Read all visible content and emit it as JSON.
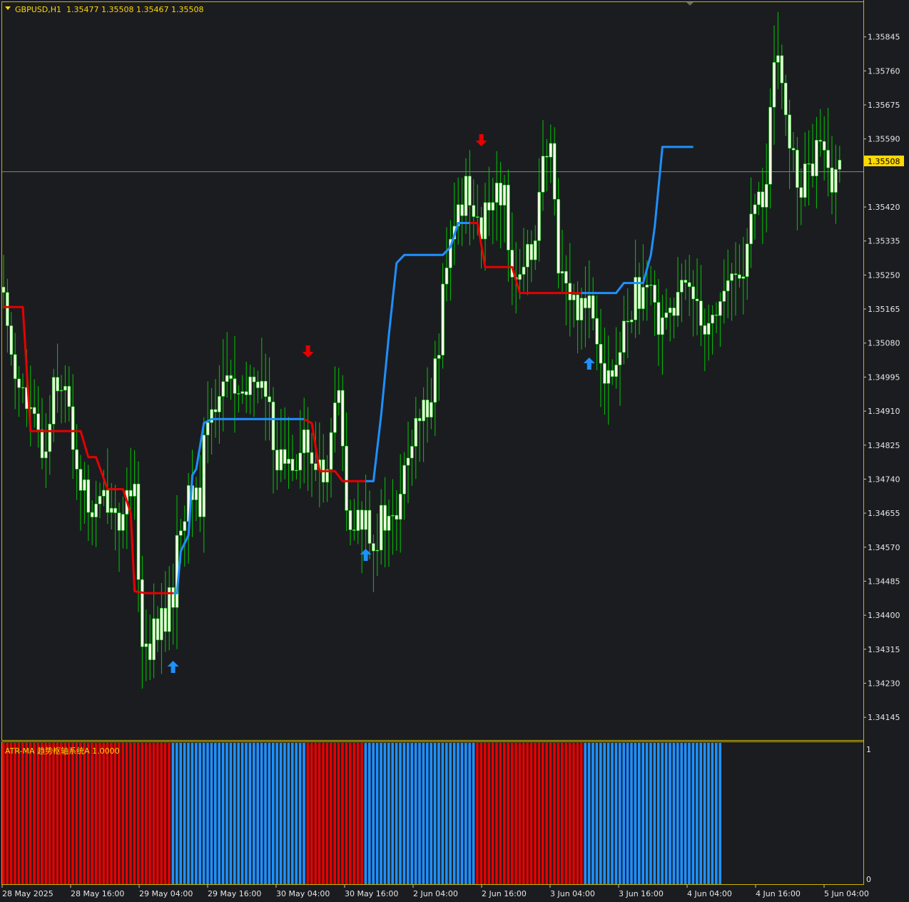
{
  "header": {
    "symbol": "GBPUSD,H1",
    "ohlc": "1.35477 1.35508 1.35467 1.35508"
  },
  "indicator": {
    "label": "ATR-MA 趋势枢轴系统A 1.0000",
    "scale_top": "1",
    "scale_bottom": "0"
  },
  "colors": {
    "background": "#1b1c20",
    "frame": "#c8b400",
    "candle_body": "#f4ffe6",
    "candle_wick": "#00c800",
    "trend_up": "#1e90ff",
    "trend_down": "#e60000",
    "current_price_bg": "#ffd800",
    "current_price_line": "#7f8a7a"
  },
  "icons": {
    "dropdown": "triangle-down-icon",
    "buy_signal": "arrow-up-icon",
    "sell_signal": "arrow-down-icon"
  },
  "chart_data": {
    "type": "candlestick",
    "symbol": "GBPUSD",
    "timeframe": "H1",
    "current_price": "1.35508",
    "ylim": [
      1.3409,
      1.3593
    ],
    "y_ticks": [
      "1.35845",
      "1.35760",
      "1.35675",
      "1.35590",
      "1.35420",
      "1.35335",
      "1.35250",
      "1.35165",
      "1.35080",
      "1.34995",
      "1.34910",
      "1.34825",
      "1.34740",
      "1.34655",
      "1.34570",
      "1.34485",
      "1.34400",
      "1.34315",
      "1.34230",
      "1.34145"
    ],
    "x_ticks": [
      "28 May 2025",
      "28 May 16:00",
      "29 May 04:00",
      "29 May 16:00",
      "30 May 04:00",
      "30 May 16:00",
      "2 Jun 04:00",
      "2 Jun 16:00",
      "3 Jun 04:00",
      "3 Jun 16:00",
      "4 Jun 04:00",
      "4 Jun 16:00",
      "5 Jun 04:00"
    ],
    "close_path": [
      [
        0,
        1.3518
      ],
      [
        3,
        1.3502
      ],
      [
        6,
        1.3492
      ],
      [
        9,
        1.3484
      ],
      [
        11,
        1.3481
      ],
      [
        13,
        1.35
      ],
      [
        15,
        1.3499
      ],
      [
        17,
        1.349
      ],
      [
        19,
        1.3478
      ],
      [
        21,
        1.347
      ],
      [
        23,
        1.3465
      ],
      [
        25,
        1.3467
      ],
      [
        27,
        1.347
      ],
      [
        29,
        1.3466
      ],
      [
        31,
        1.3463
      ],
      [
        33,
        1.347
      ],
      [
        34,
        1.3468
      ],
      [
        35,
        1.3453
      ],
      [
        36,
        1.3432
      ],
      [
        38,
        1.3433
      ],
      [
        40,
        1.3437
      ],
      [
        42,
        1.3439
      ],
      [
        44,
        1.3446
      ],
      [
        46,
        1.3465
      ],
      [
        48,
        1.3468
      ],
      [
        50,
        1.3472
      ],
      [
        51,
        1.3466
      ],
      [
        52,
        1.3484
      ],
      [
        54,
        1.3493
      ],
      [
        56,
        1.3495
      ],
      [
        58,
        1.35
      ],
      [
        60,
        1.3496
      ],
      [
        62,
        1.3491
      ],
      [
        64,
        1.3499
      ],
      [
        66,
        1.35
      ],
      [
        68,
        1.3494
      ],
      [
        70,
        1.3484
      ],
      [
        72,
        1.3478
      ],
      [
        74,
        1.3479
      ],
      [
        76,
        1.3481
      ],
      [
        78,
        1.3486
      ],
      [
        80,
        1.3475
      ],
      [
        82,
        1.3479
      ],
      [
        84,
        1.3474
      ],
      [
        85,
        1.3484
      ],
      [
        86,
        1.3496
      ],
      [
        87,
        1.3492
      ],
      [
        88,
        1.348
      ],
      [
        89,
        1.3467
      ],
      [
        90,
        1.3457
      ],
      [
        92,
        1.3463
      ],
      [
        94,
        1.3465
      ],
      [
        96,
        1.346
      ],
      [
        97,
        1.3459
      ],
      [
        98,
        1.3463
      ],
      [
        100,
        1.3464
      ],
      [
        101,
        1.3462
      ],
      [
        103,
        1.3468
      ],
      [
        105,
        1.3481
      ],
      [
        107,
        1.3485
      ],
      [
        109,
        1.349
      ],
      [
        111,
        1.3498
      ],
      [
        113,
        1.3506
      ],
      [
        114,
        1.3519
      ],
      [
        115,
        1.3525
      ],
      [
        116,
        1.3531
      ],
      [
        117,
        1.3536
      ],
      [
        118,
        1.3541
      ],
      [
        120,
        1.3547
      ],
      [
        122,
        1.3544
      ],
      [
        124,
        1.3535
      ],
      [
        126,
        1.3542
      ],
      [
        128,
        1.3549
      ],
      [
        130,
        1.3543
      ],
      [
        132,
        1.3528
      ],
      [
        134,
        1.3521
      ],
      [
        136,
        1.3528
      ],
      [
        138,
        1.3538
      ],
      [
        140,
        1.3552
      ],
      [
        142,
        1.3554
      ],
      [
        143,
        1.3542
      ],
      [
        144,
        1.353
      ],
      [
        146,
        1.3522
      ],
      [
        148,
        1.3517
      ],
      [
        150,
        1.3519
      ],
      [
        152,
        1.352
      ],
      [
        154,
        1.3512
      ],
      [
        156,
        1.3502
      ],
      [
        158,
        1.3499
      ],
      [
        160,
        1.3506
      ],
      [
        162,
        1.3514
      ],
      [
        164,
        1.3522
      ],
      [
        166,
        1.3517
      ],
      [
        168,
        1.352
      ],
      [
        170,
        1.3515
      ],
      [
        172,
        1.3518
      ],
      [
        174,
        1.3516
      ],
      [
        176,
        1.352
      ],
      [
        178,
        1.3523
      ],
      [
        180,
        1.352
      ],
      [
        182,
        1.3513
      ],
      [
        184,
        1.3514
      ],
      [
        186,
        1.3519
      ],
      [
        188,
        1.3522
      ],
      [
        190,
        1.3525
      ],
      [
        192,
        1.3527
      ],
      [
        194,
        1.3536
      ],
      [
        196,
        1.3543
      ],
      [
        198,
        1.3548
      ],
      [
        199,
        1.3566
      ],
      [
        200,
        1.3574
      ],
      [
        201,
        1.3576
      ],
      [
        203,
        1.3568
      ],
      [
        205,
        1.3552
      ],
      [
        206,
        1.3546
      ],
      [
        208,
        1.355
      ],
      [
        210,
        1.3551
      ],
      [
        212,
        1.3558
      ],
      [
        214,
        1.3548
      ],
      [
        216,
        1.3552
      ],
      [
        217,
        1.3551
      ]
    ],
    "series": [
      {
        "color": "#e60000",
        "points": [
          [
            0,
            1.3517
          ],
          [
            5,
            1.3517
          ],
          [
            7,
            1.3486
          ],
          [
            20,
            1.3486
          ],
          [
            22,
            1.34795
          ],
          [
            24,
            1.34795
          ],
          [
            27,
            1.34715
          ],
          [
            31,
            1.34715
          ],
          [
            33,
            1.34655
          ],
          [
            34,
            1.3446
          ],
          [
            37,
            1.34455
          ],
          [
            43,
            1.34455
          ],
          [
            44,
            1.34455
          ]
        ]
      },
      {
        "color": "#1e90ff",
        "points": [
          [
            44,
            1.34455
          ],
          [
            45,
            1.34455
          ],
          [
            46,
            1.3456
          ],
          [
            48,
            1.346
          ],
          [
            49,
            1.3475
          ],
          [
            50,
            1.34765
          ],
          [
            52,
            1.3488
          ],
          [
            54,
            1.3489
          ],
          [
            56,
            1.3489
          ],
          [
            78,
            1.3489
          ]
        ]
      },
      {
        "color": "#e60000",
        "points": [
          [
            78,
            1.3489
          ],
          [
            80,
            1.3488
          ],
          [
            82,
            1.3476
          ],
          [
            86,
            1.3476
          ],
          [
            88,
            1.34735
          ],
          [
            94,
            1.34735
          ]
        ]
      },
      {
        "color": "#1e90ff",
        "points": [
          [
            94,
            1.34735
          ],
          [
            96,
            1.34735
          ],
          [
            98,
            1.349
          ],
          [
            100,
            1.351
          ],
          [
            102,
            1.3528
          ],
          [
            104,
            1.353
          ],
          [
            114,
            1.353
          ],
          [
            116,
            1.3532
          ],
          [
            118,
            1.3538
          ],
          [
            121,
            1.3538
          ]
        ]
      },
      {
        "color": "#e60000",
        "points": [
          [
            121,
            1.3538
          ],
          [
            123,
            1.3538
          ],
          [
            125,
            1.3527
          ],
          [
            132,
            1.3527
          ],
          [
            134,
            1.35205
          ],
          [
            150,
            1.35205
          ]
        ]
      },
      {
        "color": "#1e90ff",
        "points": [
          [
            150,
            1.35205
          ],
          [
            159,
            1.35205
          ],
          [
            161,
            1.3523
          ],
          [
            166,
            1.3523
          ],
          [
            168,
            1.353
          ],
          [
            169,
            1.3537
          ],
          [
            171,
            1.3557
          ],
          [
            179,
            1.3557
          ]
        ]
      }
    ],
    "signals": [
      {
        "type": "buy",
        "index": 44
      },
      {
        "type": "sell",
        "index": 79
      },
      {
        "type": "buy",
        "index": 94
      },
      {
        "type": "sell",
        "index": 124
      },
      {
        "type": "buy",
        "index": 152
      }
    ],
    "histogram": [
      {
        "from": 0,
        "to": 43,
        "color": "#e60000",
        "value": 1
      },
      {
        "from": 44,
        "to": 78,
        "color": "#1e90ff",
        "value": 1
      },
      {
        "from": 79,
        "to": 93,
        "color": "#e60000",
        "value": 1
      },
      {
        "from": 94,
        "to": 122,
        "color": "#1e90ff",
        "value": 1
      },
      {
        "from": 123,
        "to": 150,
        "color": "#e60000",
        "value": 1
      },
      {
        "from": 151,
        "to": 186,
        "color": "#1e90ff",
        "value": 1
      }
    ],
    "bar_count": 187
  }
}
